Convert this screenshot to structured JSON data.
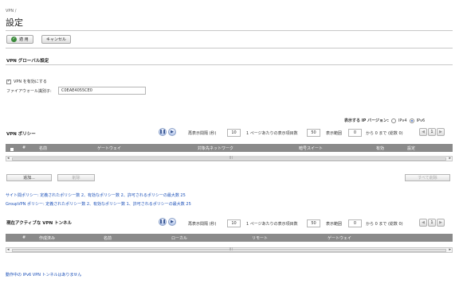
{
  "breadcrumb": "VPN /",
  "title": "設定",
  "toolbar": {
    "apply_label": "適 用",
    "cancel_label": "キャンセル"
  },
  "global": {
    "heading": "VPN グローバル設定",
    "enable_label": "VPN を有効にする",
    "enable_checked": true,
    "firewall_id_label": "ファイアウォール識別子:",
    "firewall_id_value": "C0EAE4055CE0"
  },
  "ip_version": {
    "label": "表示する IP バージョン:",
    "ipv4": "IPv4",
    "ipv6": "IPv6",
    "selected": "IPv6"
  },
  "policies": {
    "heading": "VPN ポリシー",
    "refresh_label": "再表示間隔 (秒)",
    "refresh_value": "10",
    "per_page_label": "1 ページあたりの表示項目数",
    "per_page_value": "50",
    "range_label": "表示範囲",
    "range_value": "0",
    "range_suffix": "から 0 まで (総数 0)",
    "page_value": "1",
    "columns": [
      "#",
      "名前",
      "ゲートウェイ",
      "対象先ネットワーク",
      "暗号スイート",
      "有効",
      "設定"
    ],
    "add_label": "追加...",
    "delete_label": "削除",
    "delete_all_label": "すべて削除",
    "scroll_mid": "III"
  },
  "summary": {
    "line1": "サイト間ポリシー: 定義されたポリシー数 2、有効なポリシー数 2、許可されるポリシーの最大数 25",
    "line2": "GroupVPN ポリシー: 定義されたポリシー数 2、有効なポリシー数 1、許可されるポリシーの最大数 25"
  },
  "tunnels": {
    "heading": "現在アクティブな VPN トンネル",
    "refresh_label": "再表示間隔 (秒)",
    "refresh_value": "10",
    "per_page_label": "1 ページあたりの表示項目数",
    "per_page_value": "50",
    "range_label": "表示範囲",
    "range_value": "0",
    "range_suffix": "から 0 まで (総数 0)",
    "page_value": "1",
    "columns": [
      "#",
      "作成済み",
      "名前",
      "ローカル",
      "リモート",
      "ゲートウェイ"
    ],
    "scroll_mid": "III",
    "empty_message": "動作中の IPv6 VPN トンネルはありません"
  }
}
